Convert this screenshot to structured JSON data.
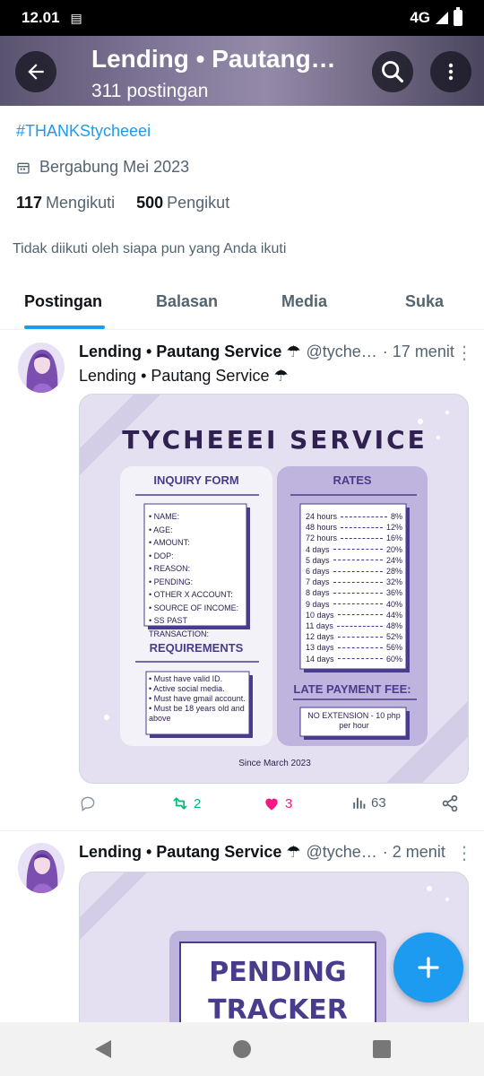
{
  "status_bar": {
    "time": "12.01",
    "network": "4G"
  },
  "header": {
    "title": "Lending • Pautang…",
    "subtitle": "311 postingan"
  },
  "profile": {
    "hashtag": "#THANKStycheeei",
    "joined": "Bergabung Mei 2023",
    "following_count": "117",
    "following_label": "Mengikuti",
    "followers_count": "500",
    "followers_label": "Pengikut",
    "not_followed": "Tidak diikuti oleh siapa pun yang Anda ikuti"
  },
  "tabs": [
    "Postingan",
    "Balasan",
    "Media",
    "Suka"
  ],
  "posts": [
    {
      "name": "Lending • Pautang Service ☂",
      "handle": "@tyche…",
      "time": "· 17 menit",
      "text": "Lending • Pautang Service ☂",
      "replies": "",
      "retweets": "2",
      "likes": "3",
      "views": "63"
    },
    {
      "name": "Lending • Pautang Service ☂",
      "handle": "@tyche…",
      "time": "· 2 menit"
    }
  ],
  "graphic1": {
    "title": "TYCHEEEI SERVICE",
    "inquiry_title": "INQUIRY FORM",
    "inquiry_fields": [
      "• NAME:",
      "• AGE:",
      "• AMOUNT:",
      "• DOP:",
      "• REASON:",
      "• PENDING:",
      "• OTHER X ACCOUNT:",
      "• SOURCE OF INCOME:",
      "• SS PAST TRANSACTION:"
    ],
    "requirements_title": "REQUIREMENTS",
    "requirements": [
      "• Must have valid ID.",
      "• Active social media.",
      "• Must have gmail account.",
      "• Must be 18 years old and above"
    ],
    "rates_title": "RATES",
    "rates": [
      {
        "term": "24 hours",
        "rate": "8%"
      },
      {
        "term": "48 hours",
        "rate": "12%"
      },
      {
        "term": "72 hours",
        "rate": "16%"
      },
      {
        "term": "4 days",
        "rate": "20%"
      },
      {
        "term": "5 days",
        "rate": "24%"
      },
      {
        "term": "6 days",
        "rate": "28%"
      },
      {
        "term": "7 days",
        "rate": "32%"
      },
      {
        "term": "8 days",
        "rate": "36%"
      },
      {
        "term": "9 days",
        "rate": "40%"
      },
      {
        "term": "10 days",
        "rate": "44%"
      },
      {
        "term": "11 days",
        "rate": "48%"
      },
      {
        "term": "12 days",
        "rate": "52%"
      },
      {
        "term": "13 days",
        "rate": "56%"
      },
      {
        "term": "14 days",
        "rate": "60%"
      }
    ],
    "late_fee_title": "LATE PAYMENT FEE:",
    "late_fee_text": "NO EXTENSION - 10 php per hour",
    "since": "Since March 2023"
  },
  "graphic2": {
    "line1": "PENDING",
    "line2": "TRACKER"
  },
  "colors": {
    "accent": "#1d9bf0",
    "retweet": "#00ba7c",
    "like": "#f91880",
    "graphic_purple": "#4a3c8c"
  }
}
